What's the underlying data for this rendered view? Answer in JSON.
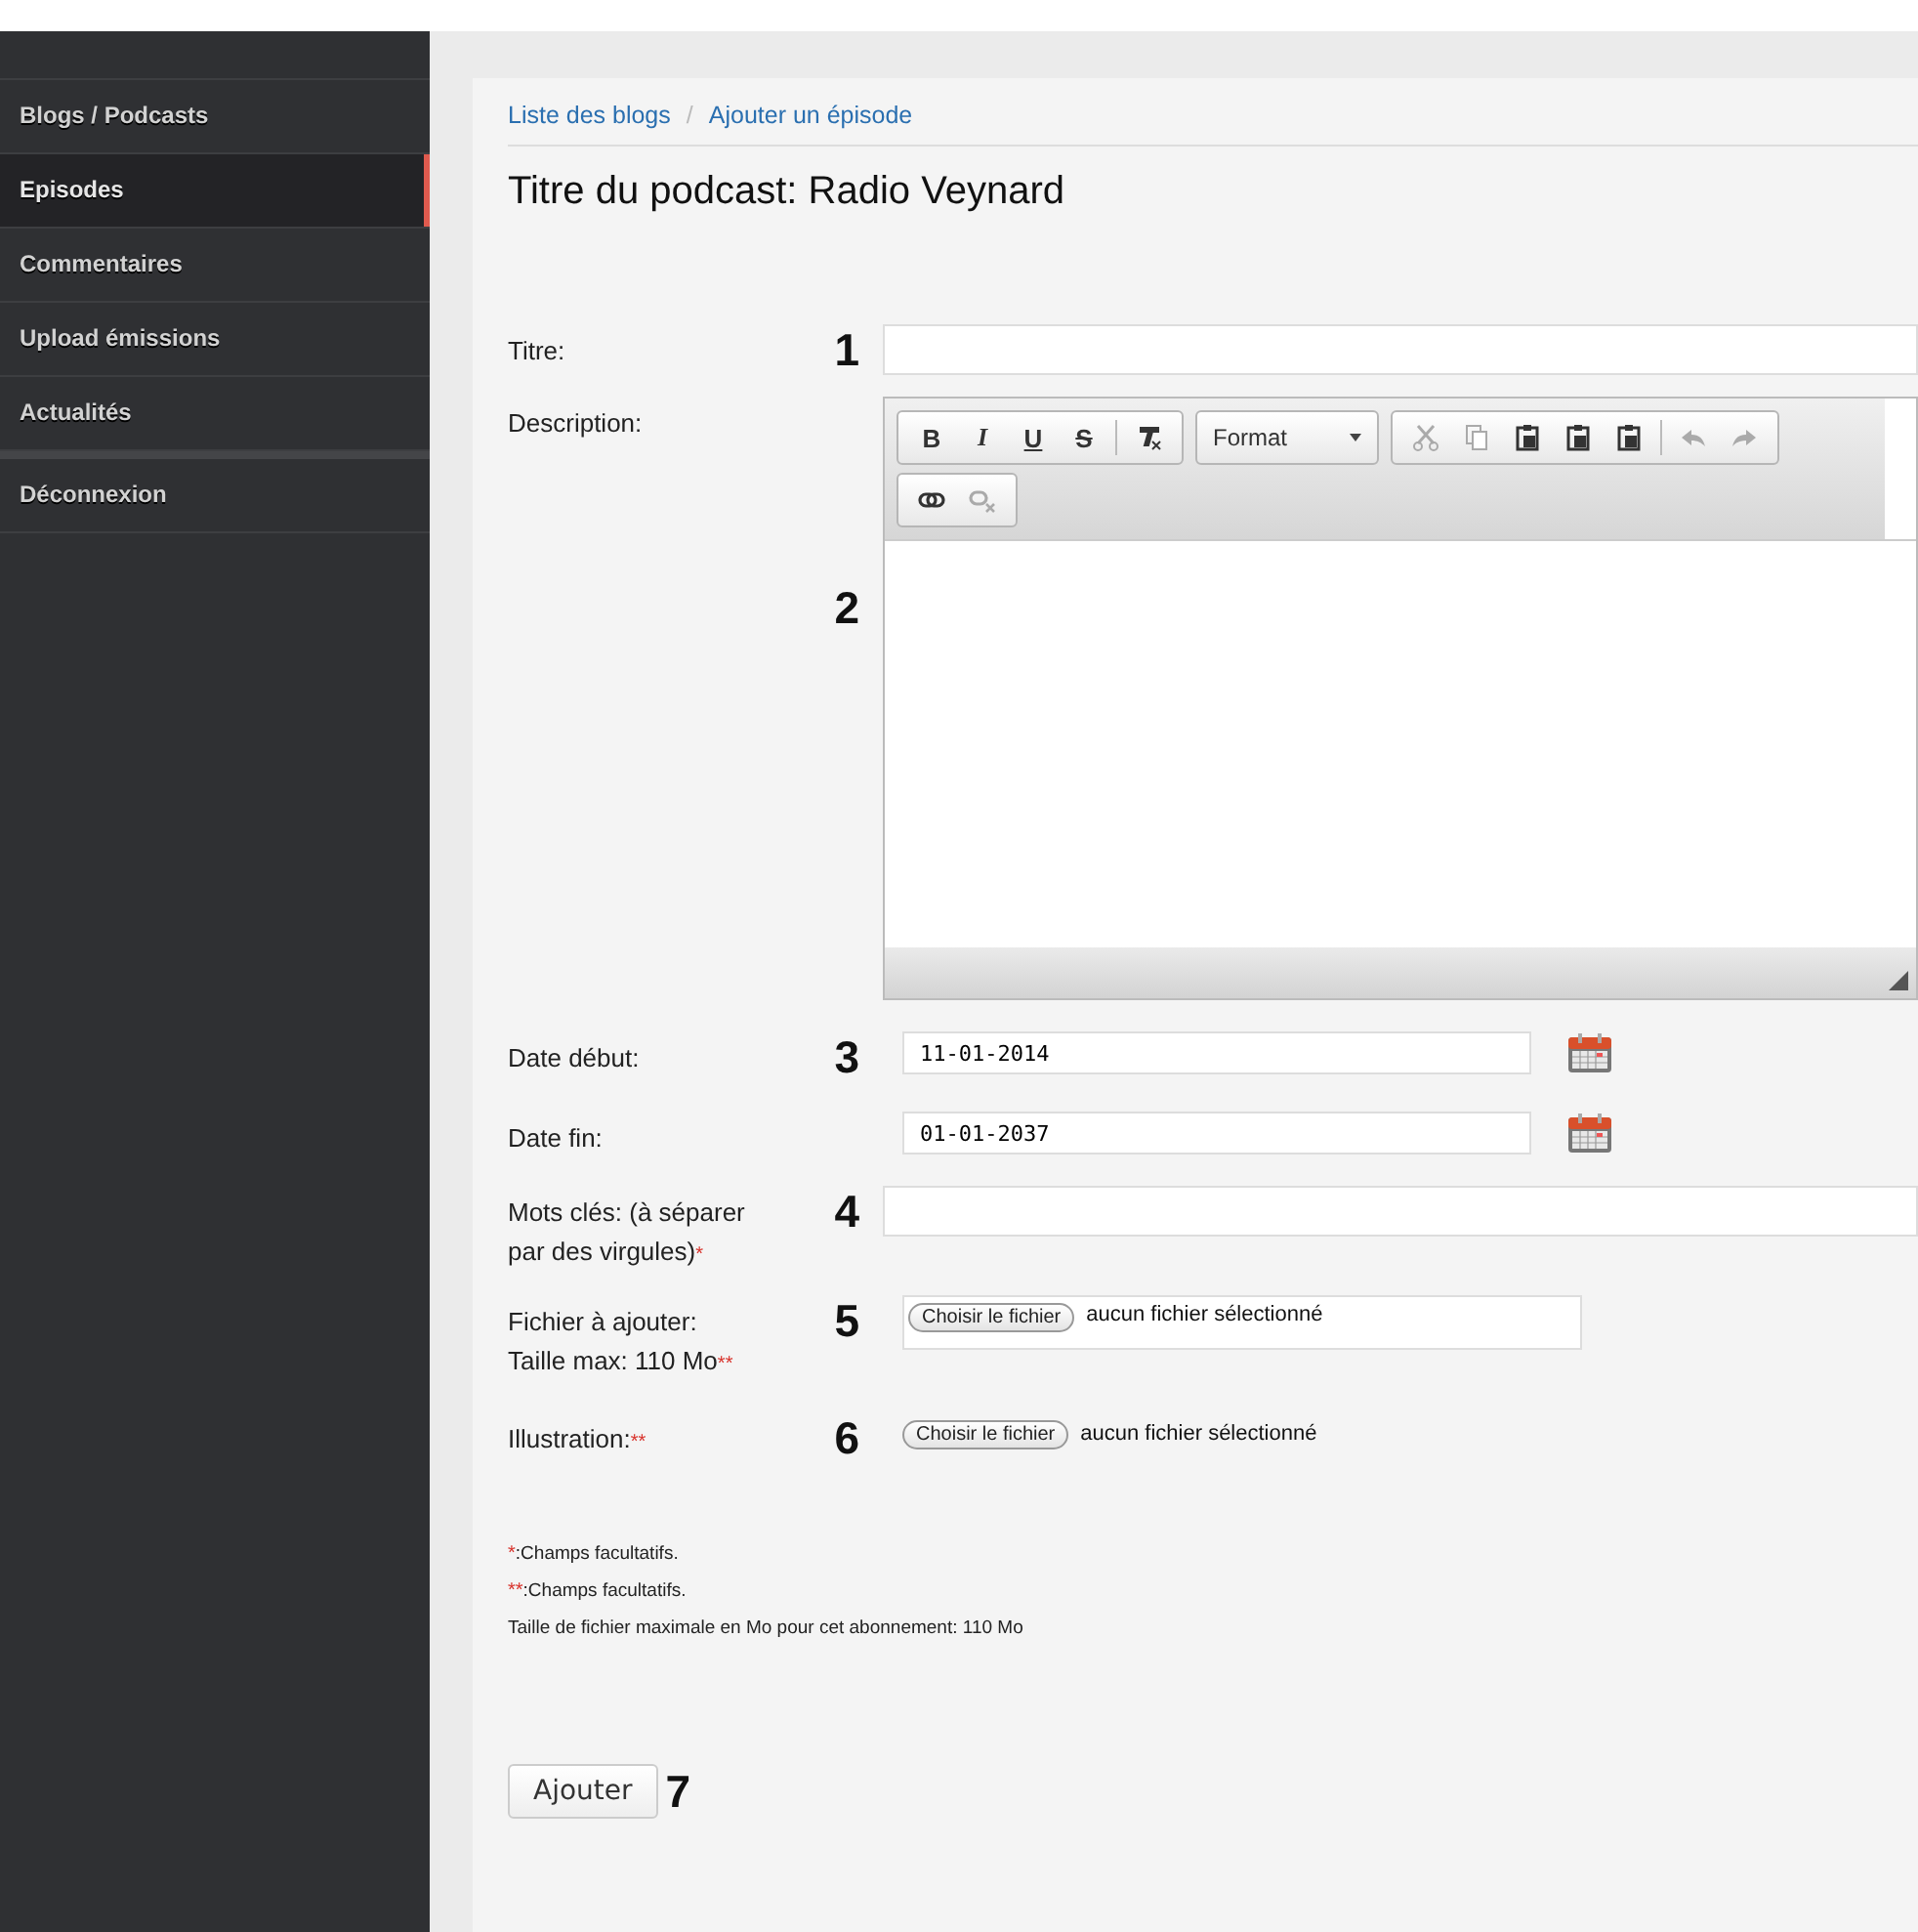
{
  "sidebar": {
    "items": [
      {
        "label": "Blogs / Podcasts",
        "selected": false
      },
      {
        "label": "Episodes",
        "selected": true
      },
      {
        "label": "Commentaires",
        "selected": false
      },
      {
        "label": "Upload émissions",
        "selected": false
      },
      {
        "label": "Actualités",
        "selected": false
      },
      {
        "label": "Déconnexion",
        "selected": false
      }
    ]
  },
  "breadcrumb": [
    "Liste des blogs",
    "Ajouter un épisode"
  ],
  "breadcrumb_separator": "/",
  "title": "Titre du podcast: Radio Veynard",
  "fields": [
    {
      "kind": "text",
      "label": "Titre:",
      "number": "1"
    },
    {
      "kind": "editor",
      "label": "Description:",
      "number": "2",
      "toolbar": [
        [
          {
            "kind": "letter",
            "glyph": "B"
          },
          {
            "kind": "letter",
            "glyph": "I"
          },
          {
            "kind": "letter",
            "glyph": "U"
          },
          {
            "kind": "letter",
            "glyph": "S"
          },
          {
            "kind": "sep"
          },
          {
            "kind": "icon"
          }
        ],
        [
          {
            "kind": "select",
            "label": "Format"
          }
        ],
        [
          {
            "kind": "icon",
            "disabled": true
          },
          {
            "kind": "icon",
            "disabled": true
          },
          {
            "kind": "icon",
            "disabled": false
          },
          {
            "kind": "icon",
            "disabled": false
          },
          {
            "kind": "icon",
            "disabled": false
          },
          {
            "kind": "sep"
          },
          {
            "kind": "icon",
            "disabled": true
          },
          {
            "kind": "icon",
            "disabled": true
          }
        ],
        [
          {
            "kind": "icon",
            "disabled": false
          },
          {
            "kind": "icon",
            "disabled": true
          }
        ]
      ]
    },
    {
      "kind": "date",
      "label": "Date début:",
      "number": "3",
      "value": "11-01-2014"
    },
    {
      "kind": "date",
      "label": "Date fin:",
      "value": "01-01-2037"
    },
    {
      "kind": "text",
      "label": "Mots clés: (à séparer par des virgules)",
      "mark": "*",
      "number": "4"
    },
    {
      "kind": "file",
      "label": "Fichier à ajouter: Taille max: 110 Mo",
      "mark": "**",
      "number": "5",
      "button": "Choisir le fichier",
      "status": "aucun fichier sélectionné",
      "boxed": true
    },
    {
      "kind": "file",
      "label": "Illustration:",
      "mark": "**",
      "number": "6",
      "button": "Choisir le fichier",
      "status": "aucun fichier sélectionné",
      "boxed": false
    }
  ],
  "notes": [
    {
      "mark": "*",
      "text": ":Champs facultatifs."
    },
    {
      "mark": "**",
      "text": ":Champs facultatifs."
    },
    {
      "text": "Taille de fichier maximale en Mo pour cet abonnement: 110 Mo"
    }
  ],
  "submit": {
    "label": "Ajouter",
    "number": "7"
  }
}
